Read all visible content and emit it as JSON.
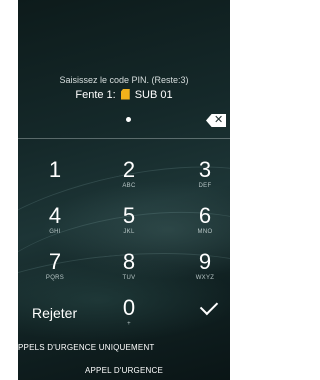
{
  "pin_prompt": "Saisissez le code PIN. (Reste:3)",
  "sim_slot": {
    "label": "Fente 1:",
    "icon": "sim-card-icon",
    "name": "SUB 01"
  },
  "pin_entry": {
    "digits_entered": 1
  },
  "delete_icon": "backspace-icon",
  "keypad": [
    {
      "digit": "1",
      "letters": ""
    },
    {
      "digit": "2",
      "letters": "ABC"
    },
    {
      "digit": "3",
      "letters": "DEF"
    },
    {
      "digit": "4",
      "letters": "GHI"
    },
    {
      "digit": "5",
      "letters": "JKL"
    },
    {
      "digit": "6",
      "letters": "MNO"
    },
    {
      "digit": "7",
      "letters": "PQRS"
    },
    {
      "digit": "8",
      "letters": "TUV"
    },
    {
      "digit": "9",
      "letters": "WXYZ"
    },
    {
      "digit": "0",
      "letters": "+"
    }
  ],
  "reject_label": "Rejeter",
  "ok_icon": "checkmark-icon",
  "emergency_only_text": "PPELS D'URGENCE UNIQUEMENT",
  "emergency_call_label": "APPEL D'URGENCE",
  "colors": {
    "background": "#14292a",
    "sim_icon": "#f2b21b",
    "text": "#ffffff"
  }
}
